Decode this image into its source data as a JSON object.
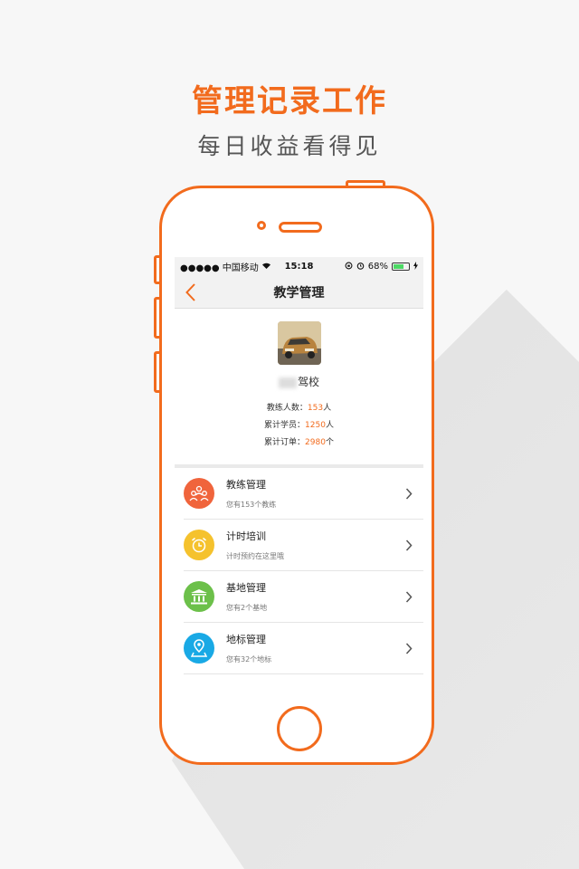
{
  "promo": {
    "headline": "管理记录工作",
    "subline": "每日收益看得见"
  },
  "status_bar": {
    "carrier": "●●●●● 中国移动",
    "time": "15:18",
    "battery": "68%",
    "battery_fraction": 0.68
  },
  "nav": {
    "title": "教学管理"
  },
  "profile": {
    "school_suffix": "驾校",
    "stats": [
      {
        "label": "教练人数：",
        "value": "153",
        "unit": "人"
      },
      {
        "label": "累计学员：",
        "value": "1250",
        "unit": "人"
      },
      {
        "label": "累计订单：",
        "value": "2980",
        "unit": "个"
      }
    ]
  },
  "menu": [
    {
      "title": "教练管理",
      "subtitle": "您有153个教练",
      "color": "#f0643c",
      "icon": "people-icon"
    },
    {
      "title": "计时培训",
      "subtitle": "计时预约在这里哦",
      "color": "#f5c22d",
      "icon": "alarm-clock-icon"
    },
    {
      "title": "基地管理",
      "subtitle": "您有2个基地",
      "color": "#6cc04a",
      "icon": "building-icon"
    },
    {
      "title": "地标管理",
      "subtitle": "您有32个地标",
      "color": "#19a9e5",
      "icon": "location-pin-icon"
    }
  ],
  "colors": {
    "accent": "#f26b1d"
  }
}
